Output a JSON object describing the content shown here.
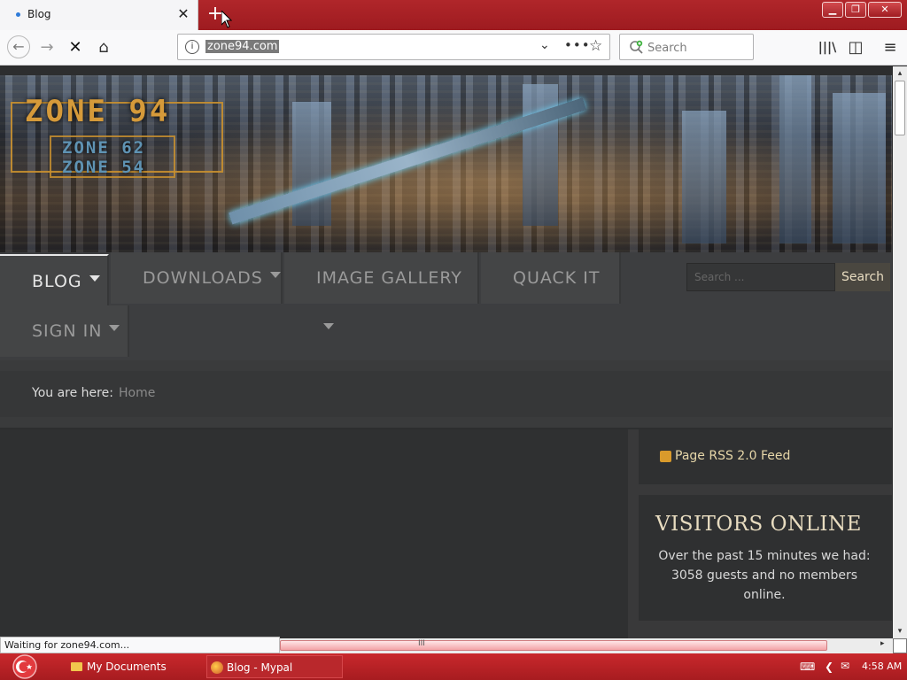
{
  "browser": {
    "tab": {
      "title": "Blog",
      "close_glyph": "✕"
    },
    "new_tab_glyph": "+",
    "window_controls": {
      "minimize": "▁",
      "restore": "❐",
      "close": "✕"
    },
    "nav": {
      "back": "←",
      "forward": "→",
      "stop": "✕",
      "home": "⌂"
    },
    "url": "zone94.com",
    "url_controls": {
      "dropdown": "⌄",
      "more": "•••",
      "bookmark": "☆"
    },
    "search_placeholder": "Search",
    "toolbar_right": {
      "library": "|||\\",
      "sidebar": "◫",
      "menu": "≡"
    }
  },
  "site": {
    "logo": {
      "main": "ZONE 94",
      "sub1": "ZONE 62",
      "sub2": "ZONE 54"
    },
    "menu": [
      {
        "label": "BLOG",
        "has_dropdown": true,
        "active": true
      },
      {
        "label": "DOWNLOADS",
        "has_dropdown": true,
        "active": false
      },
      {
        "label": "IMAGE GALLERY",
        "has_dropdown": true,
        "active": false
      },
      {
        "label": "QUACK IT",
        "has_dropdown": false,
        "active": false
      },
      {
        "label": "SIGN IN",
        "has_dropdown": true,
        "active": false
      }
    ],
    "search": {
      "placeholder": "Search ...",
      "button": "Search"
    },
    "breadcrumb": {
      "label": "You are here:",
      "current": "Home"
    },
    "sidebar": {
      "rss": "Page RSS 2.0 Feed",
      "visitors_title": "VISITORS ONLINE",
      "visitors_text": "Over the past 15 minutes we had: 3058 guests and no members online."
    }
  },
  "status": {
    "text": "Waiting for zone94.com...",
    "hscroll": {
      "left": "◂",
      "grip": "III",
      "right": "▸"
    },
    "vscroll": {
      "up": "▴",
      "down": "▾"
    }
  },
  "taskbar": {
    "items": [
      {
        "label": "My Documents"
      },
      {
        "label": "Blog - Mypal"
      }
    ],
    "tray": {
      "keyboard": "⌨",
      "chevron": "❮",
      "network": "✉",
      "volume": "🔊"
    },
    "clock": "4:58 AM"
  },
  "colors": {
    "titlebar": "#b0262a",
    "accent_text": "#e8dcc0",
    "logo_orange": "#d59a3a"
  }
}
